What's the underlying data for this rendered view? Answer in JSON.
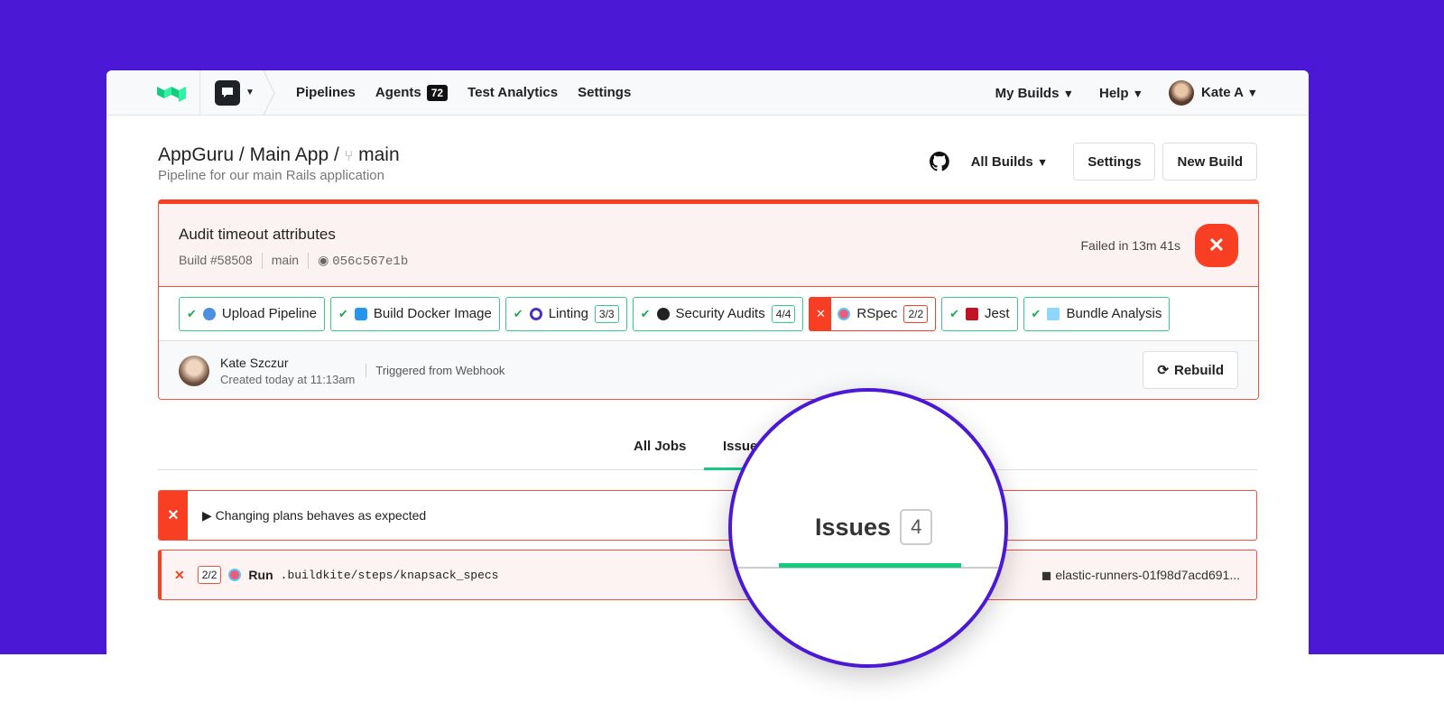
{
  "nav": {
    "items": [
      "Pipelines",
      "Agents",
      "Test Analytics",
      "Settings"
    ],
    "agents_count": "72",
    "my_builds": "My Builds",
    "help": "Help",
    "user": "Kate A"
  },
  "header": {
    "org": "AppGuru",
    "pipeline": "Main App",
    "branch": "main",
    "description": "Pipeline for our main Rails application",
    "all_builds": "All Builds",
    "settings": "Settings",
    "new_build": "New Build"
  },
  "build": {
    "title": "Audit timeout attributes",
    "number": "Build #58508",
    "branch": "main",
    "commit": "056c567e1b",
    "status": "Failed in 13m 41s",
    "jobs": [
      {
        "label": "Upload Pipeline",
        "count": null
      },
      {
        "label": "Build Docker Image",
        "count": null
      },
      {
        "label": "Linting",
        "count": "3/3"
      },
      {
        "label": "Security Audits",
        "count": "4/4"
      },
      {
        "label": "RSpec",
        "count": "2/2"
      },
      {
        "label": "Jest",
        "count": null
      },
      {
        "label": "Bundle Analysis",
        "count": null
      }
    ],
    "author": "Kate Szczur",
    "created": "Created today at 11:13am",
    "trigger": "Triggered from Webhook",
    "rebuild": "Rebuild"
  },
  "tabs": {
    "all_jobs": "All Jobs",
    "issues": "Issues",
    "issues_count": "4"
  },
  "issues": {
    "row1": "Changing plans behaves as expected",
    "row2_count": "2/2",
    "row2_run": "Run",
    "row2_cmd": ".buildkite/steps/knapsack_specs",
    "row2_agent": "elastic-runners-01f98d7acd691..."
  }
}
